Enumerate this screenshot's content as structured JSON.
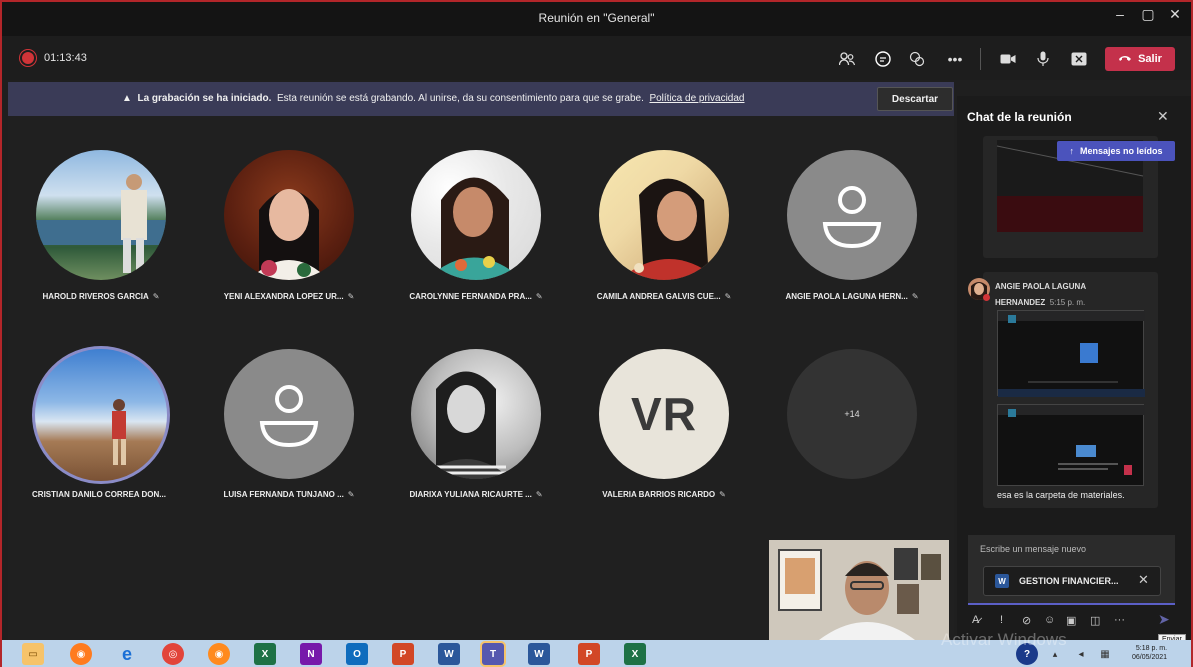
{
  "window": {
    "title": "Reunión en \"General\""
  },
  "toolbar": {
    "timer": "01:13:43",
    "leave_label": "Salir"
  },
  "banner": {
    "title": "La grabación se ha iniciado.",
    "message": "Esta reunión se está grabando. Al unirse, da su consentimiento para que se grabe.",
    "link": "Política de privacidad",
    "dismiss_label": "Descartar"
  },
  "participants": [
    {
      "name": "HAROLD RIVEROS GARCIA"
    },
    {
      "name": "YENI ALEXANDRA LOPEZ UR..."
    },
    {
      "name": "CAROLYNNE FERNANDA PRA..."
    },
    {
      "name": "CAMILA ANDREA GALVIS CUE..."
    },
    {
      "name": "ANGIE PAOLA LAGUNA HERN..."
    },
    {
      "name": "CRISTIAN DANILO CORREA DON..."
    },
    {
      "name": "LUISA FERNANDA TUNJANO ..."
    },
    {
      "name": "DIARIXA YULIANA RICAURTE ..."
    },
    {
      "name": "VALERIA BARRIOS RICARDO",
      "initials": "VR"
    },
    {
      "overflow": "+14"
    }
  ],
  "chat": {
    "title": "Chat de la reunión",
    "unread_label": "Mensajes no leídos",
    "message": {
      "author_line1": "ANGIE PAOLA LAGUNA",
      "author_line2": "HERNANDEZ",
      "time": "5:15 p. m.",
      "text": "esa es la carpeta de materiales."
    },
    "compose_placeholder": "Escribe un mensaje nuevo",
    "attachment_name": "GESTION FINANCIER...",
    "send_tooltip": "Enviar"
  },
  "taskbar": {
    "time": "5:18 p. m.",
    "date": "06/05/2021"
  },
  "watermark": "Activar Windows",
  "colors": {
    "accent": "#5b5fc7",
    "leave": "#c4314b",
    "banner": "#3a3b57",
    "recording": "#d13438"
  }
}
